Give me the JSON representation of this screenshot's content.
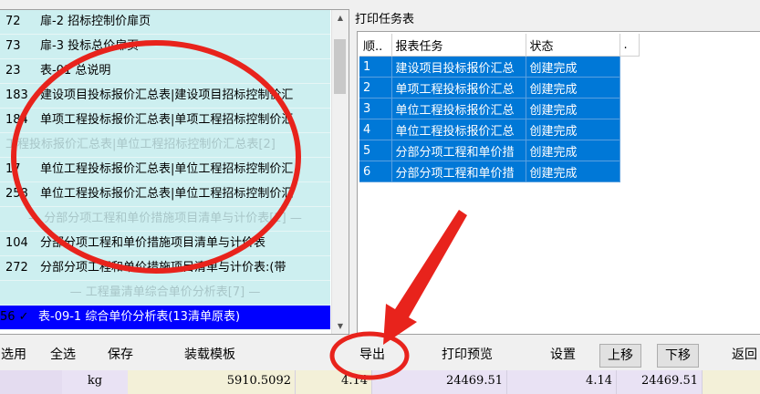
{
  "left_list": {
    "rows": [
      {
        "num": "72",
        "text": "扉-2 招标控制价扉页",
        "kind": "normal"
      },
      {
        "num": "73",
        "text": "扉-3 投标总价扉页",
        "kind": "normal"
      },
      {
        "num": "23",
        "text": "表-01 总说明",
        "kind": "normal"
      },
      {
        "num": "183",
        "text": "建设项目投标报价汇总表|建设项目招标控制价汇",
        "kind": "normal"
      },
      {
        "num": "184",
        "text": "单项工程投标报价汇总表|单项工程招标控制价汇",
        "kind": "normal"
      },
      {
        "num": "",
        "text": "工程投标报价汇总表|单位工程招标控制价汇总表[2]",
        "kind": "cut"
      },
      {
        "num": "17",
        "text": "单位工程投标报价汇总表|单位工程招标控制价汇",
        "kind": "normal"
      },
      {
        "num": "258",
        "text": "单位工程投标报价汇总表|单位工程招标控制价汇",
        "kind": "normal"
      },
      {
        "num": "",
        "text": "— 分部分项工程和单价措施项目清单与计价表[2] —",
        "kind": "group"
      },
      {
        "num": "104",
        "text": "分部分项工程和单价措施项目清单与计价表",
        "kind": "normal"
      },
      {
        "num": "272",
        "text": "分部分项工程和单价措施项目清单与计价表:(带",
        "kind": "normal"
      },
      {
        "num": "",
        "text": "— 工程量清单综合单价分析表[7] —",
        "kind": "group"
      },
      {
        "num": "56 ✓",
        "text": "表-09-1 综合单价分析表(13清单原表)",
        "kind": "sel"
      }
    ]
  },
  "right_panel": {
    "title": "打印任务表",
    "columns": [
      "顺..",
      "报表任务",
      "状态",
      "."
    ],
    "rows": [
      {
        "idx": "1",
        "task": "建设项目投标报价汇总",
        "status": "创建完成"
      },
      {
        "idx": "2",
        "task": "单项工程投标报价汇总",
        "status": "创建完成"
      },
      {
        "idx": "3",
        "task": "单位工程投标报价汇总",
        "status": "创建完成"
      },
      {
        "idx": "4",
        "task": "单位工程投标报价汇总",
        "status": "创建完成"
      },
      {
        "idx": "5",
        "task": "分部分项工程和单价措",
        "status": "创建完成"
      },
      {
        "idx": "6",
        "task": "分部分项工程和单价措",
        "status": "创建完成"
      }
    ]
  },
  "toolbar": {
    "select": "选用",
    "select_all": "全选",
    "save": "保存",
    "load_template": "装载模板",
    "export": "导出",
    "print_preview": "打印预览",
    "settings": "设置",
    "move_up": "上移",
    "move_down": "下移",
    "back": "返回"
  },
  "data_row": {
    "unit": "kg",
    "qty": "5910.5092",
    "price": "4.14",
    "total": "24469.51",
    "price2": "4.14",
    "total2": "24469.51"
  },
  "colors": {
    "list_bg": "#cdeff0",
    "selection": "#0000ff",
    "task_selection": "#0078d7",
    "annotation": "#e8231c"
  }
}
